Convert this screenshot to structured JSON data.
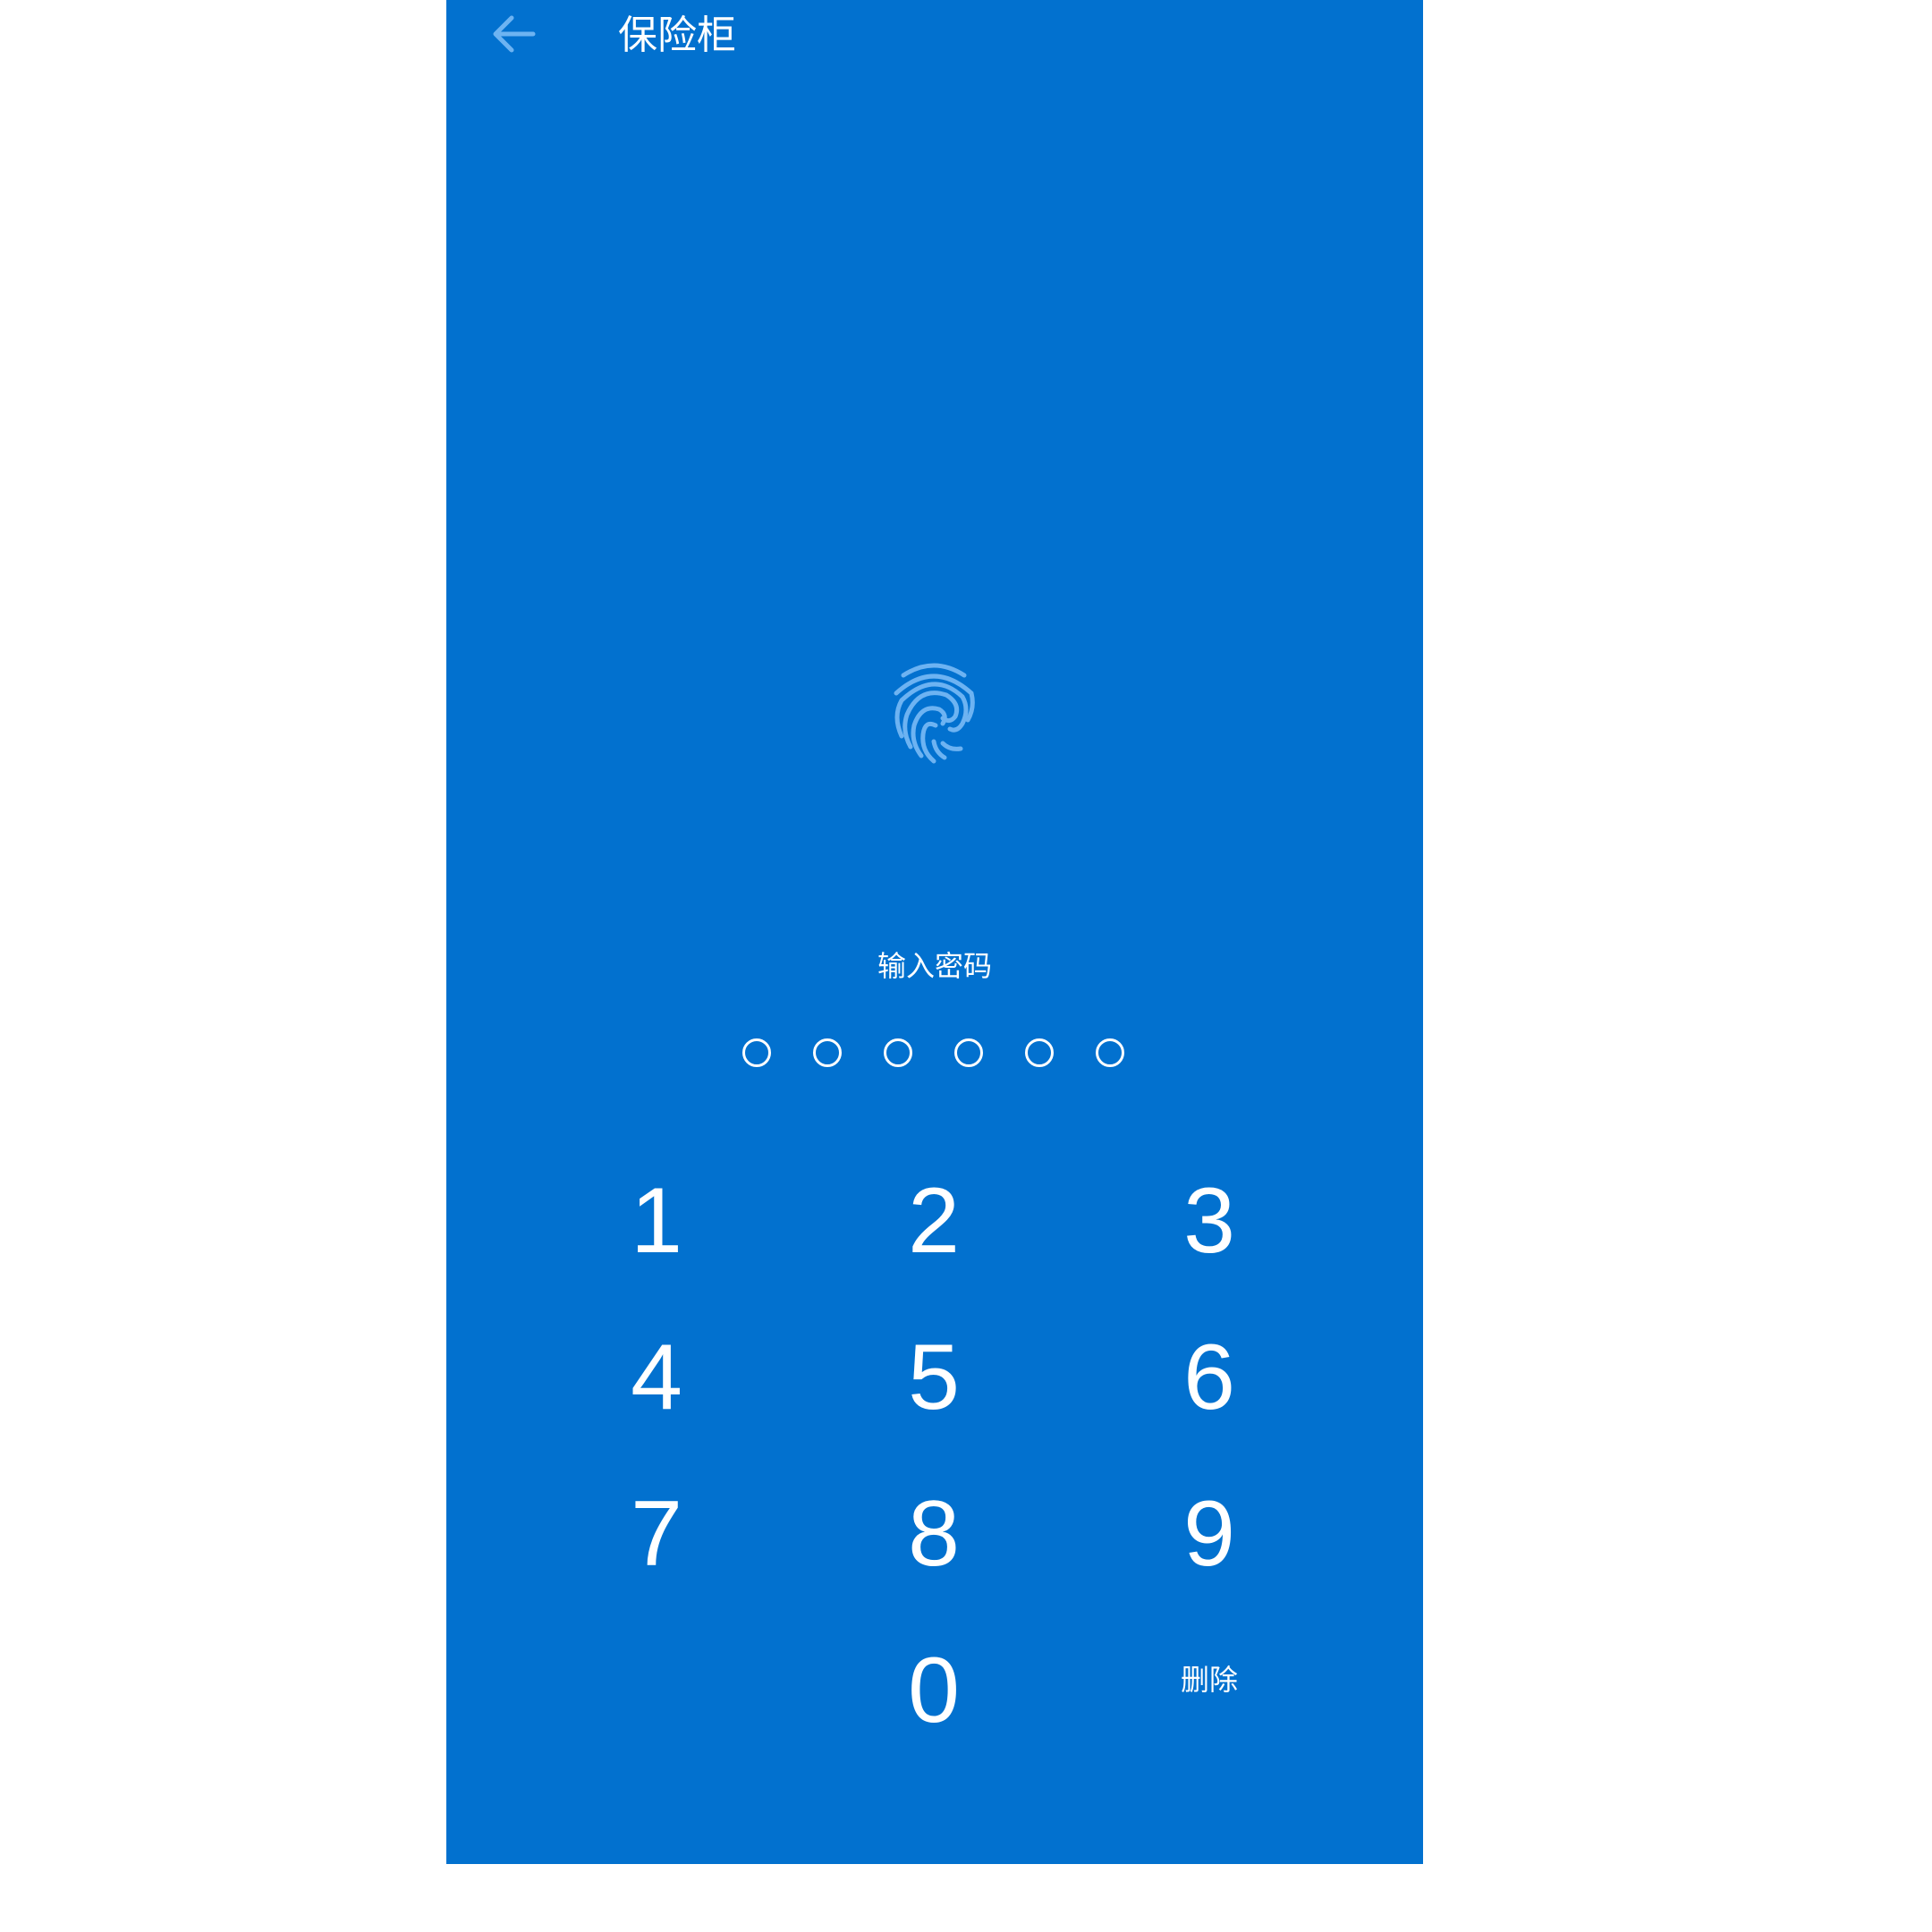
{
  "header": {
    "back_icon": "arrow-left-icon",
    "title": "保险柜"
  },
  "lock": {
    "fingerprint_icon": "fingerprint-icon",
    "prompt": "输入密码",
    "pin_length": 6,
    "pin_filled": 0
  },
  "keypad": {
    "keys": [
      "1",
      "2",
      "3",
      "4",
      "5",
      "6",
      "7",
      "8",
      "9",
      "",
      "0",
      "删除"
    ]
  },
  "colors": {
    "background": "#0271cf",
    "accent_light": "#6db3f2",
    "text": "#ffffff"
  }
}
